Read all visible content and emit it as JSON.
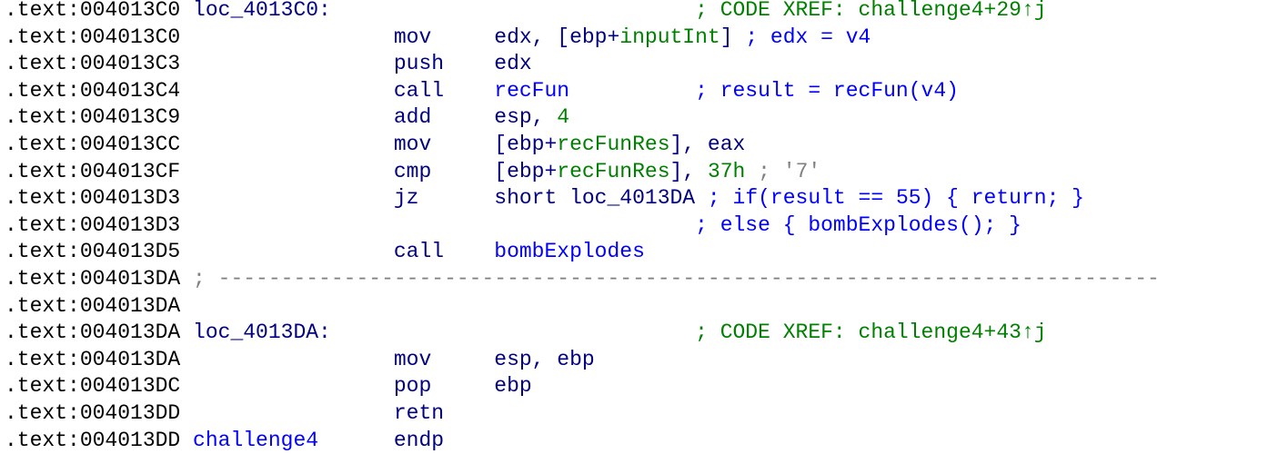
{
  "colors": {
    "navy": "#000080",
    "blue": "#0000ff",
    "green": "#008000",
    "gray": "#808080"
  },
  "lines": [
    {
      "addr": ".text:004013C0",
      "label": "loc_4013C0:",
      "mnem": "",
      "ops": [],
      "comment": {
        "t": "; CODE XREF: challenge4+29↑j",
        "c": "green"
      }
    },
    {
      "addr": ".text:004013C0",
      "label": "",
      "mnem": "mov",
      "ops": [
        {
          "t": "edx, [ebp+",
          "c": "navy"
        },
        {
          "t": "inputInt",
          "c": "green"
        },
        {
          "t": "]",
          "c": "navy"
        }
      ],
      "comment": {
        "t": "; edx = v4",
        "c": "blue"
      }
    },
    {
      "addr": ".text:004013C3",
      "label": "",
      "mnem": "push",
      "ops": [
        {
          "t": "edx",
          "c": "navy"
        }
      ],
      "comment": null
    },
    {
      "addr": ".text:004013C4",
      "label": "",
      "mnem": "call",
      "ops": [
        {
          "t": "recFun",
          "c": "blue"
        }
      ],
      "comment": {
        "t": "; result = recFun(v4)",
        "c": "blue"
      }
    },
    {
      "addr": ".text:004013C9",
      "label": "",
      "mnem": "add",
      "ops": [
        {
          "t": "esp, ",
          "c": "navy"
        },
        {
          "t": "4",
          "c": "green"
        }
      ],
      "comment": null
    },
    {
      "addr": ".text:004013CC",
      "label": "",
      "mnem": "mov",
      "ops": [
        {
          "t": "[ebp+",
          "c": "navy"
        },
        {
          "t": "recFunRes",
          "c": "green"
        },
        {
          "t": "], eax",
          "c": "navy"
        }
      ],
      "comment": null
    },
    {
      "addr": ".text:004013CF",
      "label": "",
      "mnem": "cmp",
      "ops": [
        {
          "t": "[ebp+",
          "c": "navy"
        },
        {
          "t": "recFunRes",
          "c": "green"
        },
        {
          "t": "], ",
          "c": "navy"
        },
        {
          "t": "37h",
          "c": "green"
        }
      ],
      "comment": {
        "t": "; '7'",
        "c": "gray"
      }
    },
    {
      "addr": ".text:004013D3",
      "label": "",
      "mnem": "jz",
      "ops": [
        {
          "t": "short loc_4013DA",
          "c": "navy"
        }
      ],
      "comment": {
        "t": "; if(result == 55) { return; }",
        "c": "blue"
      }
    },
    {
      "addr": ".text:004013D3",
      "label": "",
      "mnem": "",
      "ops": [],
      "comment": {
        "t": "; else { bombExplodes(); }",
        "c": "blue"
      }
    },
    {
      "addr": ".text:004013D5",
      "label": "",
      "mnem": "call",
      "ops": [
        {
          "t": "bombExplodes",
          "c": "blue"
        }
      ],
      "comment": null
    },
    {
      "addr": ".text:004013DA",
      "separator": "; ---------------------------------------------------------------------------"
    },
    {
      "addr": ".text:004013DA",
      "label": "",
      "mnem": "",
      "ops": [],
      "comment": null
    },
    {
      "addr": ".text:004013DA",
      "label": "loc_4013DA:",
      "mnem": "",
      "ops": [],
      "comment": {
        "t": "; CODE XREF: challenge4+43↑j",
        "c": "green"
      }
    },
    {
      "addr": ".text:004013DA",
      "label": "",
      "mnem": "mov",
      "ops": [
        {
          "t": "esp, ebp",
          "c": "navy"
        }
      ],
      "comment": null
    },
    {
      "addr": ".text:004013DC",
      "label": "",
      "mnem": "pop",
      "ops": [
        {
          "t": "ebp",
          "c": "navy"
        }
      ],
      "comment": null
    },
    {
      "addr": ".text:004013DD",
      "label": "",
      "mnem": "retn",
      "ops": [],
      "comment": null
    },
    {
      "addr": ".text:004013DD",
      "label": "challenge4",
      "labelColor": "blue",
      "mnem": "endp",
      "ops": [],
      "comment": null
    }
  ]
}
